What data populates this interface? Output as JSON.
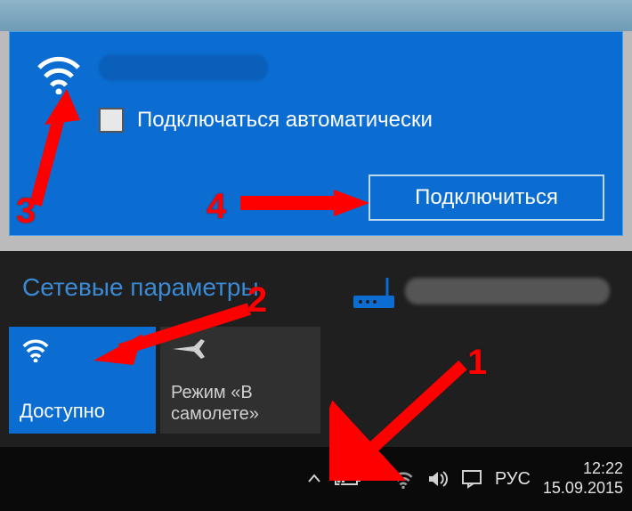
{
  "wifi_network": {
    "auto_connect_label": "Подключаться автоматически",
    "connect_button": "Подключиться"
  },
  "network_settings": {
    "heading": "Сетевые параметры",
    "wifi_tile_label": "Доступно",
    "airplane_tile_label": "Режим «В самолете»"
  },
  "taskbar": {
    "language": "РУС",
    "time": "12:22",
    "date": "15.09.2015"
  },
  "annotations": {
    "n1": "1",
    "n2": "2",
    "n3": "3",
    "n4": "4"
  },
  "colors": {
    "accent": "#0b6dd1",
    "annot": "#ff0000"
  }
}
